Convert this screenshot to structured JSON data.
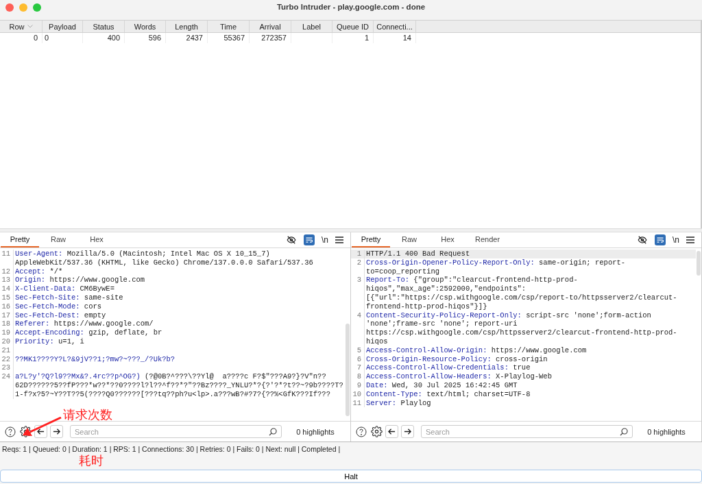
{
  "window": {
    "title": "Turbo Intruder - play.google.com - done"
  },
  "table": {
    "columns": [
      {
        "label": "Row",
        "sorted": true
      },
      {
        "label": "Payload",
        "sorted": false
      },
      {
        "label": "Status",
        "sorted": false
      },
      {
        "label": "Words",
        "sorted": false
      },
      {
        "label": "Length",
        "sorted": false
      },
      {
        "label": "Time",
        "sorted": false
      },
      {
        "label": "Arrival",
        "sorted": false
      },
      {
        "label": "Label",
        "sorted": false
      },
      {
        "label": "Queue ID",
        "sorted": false
      },
      {
        "label": "Connecti...",
        "sorted": false
      }
    ],
    "rows": [
      {
        "cells": [
          "0",
          "0",
          "400",
          "596",
          "2437",
          "55367",
          "272357",
          null,
          "1",
          "14"
        ]
      }
    ]
  },
  "panes": [
    {
      "tabs": [
        {
          "label": "Pretty",
          "selected": true
        },
        {
          "label": "Raw",
          "selected": false
        },
        {
          "label": "Hex",
          "selected": false
        }
      ],
      "toolbar": {
        "hide_on": false,
        "wrap_on": true,
        "newline_label": "\\n"
      },
      "lines": [
        {
          "num": "11",
          "key": "User-Agent:",
          "value": "Mozilla/5.0 (Macintosh; Intel Mac OS X 10_15_7) AppleWebKit/537.36 (KHTML, like Gecko) Chrome/137.0.0.0 Safari/537.36",
          "selected": false
        },
        {
          "num": "12",
          "key": "Accept:",
          "value": "*/*",
          "selected": false
        },
        {
          "num": "13",
          "key": "Origin:",
          "value": "https://www.google.com",
          "selected": false
        },
        {
          "num": "14",
          "key": "X-Client-Data:",
          "value": "CM6BywE=",
          "selected": false
        },
        {
          "num": "15",
          "key": "Sec-Fetch-Site:",
          "value": "same-site",
          "selected": false
        },
        {
          "num": "16",
          "key": "Sec-Fetch-Mode:",
          "value": "cors",
          "selected": false
        },
        {
          "num": "17",
          "key": "Sec-Fetch-Dest:",
          "value": "empty",
          "selected": false
        },
        {
          "num": "18",
          "key": "Referer:",
          "value": "https://www.google.com/",
          "selected": false
        },
        {
          "num": "19",
          "key": "Accept-Encoding:",
          "value": "gzip, deflate, br",
          "selected": false
        },
        {
          "num": "20",
          "key": "Priority:",
          "value": "u=1, i",
          "selected": false
        },
        {
          "num": "21",
          "selected": false
        },
        {
          "num": "22",
          "key": "??MK1????Y?L?&9jV??1;?mw?~???_/?Uk?b?",
          "selected": false
        },
        {
          "num": "23",
          "selected": false
        },
        {
          "num": "24",
          "key": "a?L?y'?Q?l9??Mx&?.4rc??p^OG?)",
          "value": "(?@0B?^???\\??Yl@  a????c F?$\"???A9?}?V\"n??62D??????5??fP???*w??*??0????l?l??^f??*?\"??Bz????_YNLU?*?{?'?*?t??~?9b????T?1-f?x?5?~Y??T??5(????Q0??????[???tq??ph?u<lp>.a???wB?#?7?{??%<GfK???If???",
          "selected": false
        }
      ],
      "search": {
        "placeholder": "Search",
        "highlights": "0 highlights"
      }
    },
    {
      "tabs": [
        {
          "label": "Pretty",
          "selected": true
        },
        {
          "label": "Raw",
          "selected": false
        },
        {
          "label": "Hex",
          "selected": false
        },
        {
          "label": "Render",
          "selected": false
        }
      ],
      "toolbar": {
        "hide_on": false,
        "wrap_on": true,
        "newline_label": "\\n"
      },
      "lines": [
        {
          "num": "1",
          "value": "HTTP/1.1 400 Bad Request",
          "selected": true
        },
        {
          "num": "2",
          "key": "Cross-Origin-Opener-Policy-Report-Only:",
          "value": "same-origin; report-to=coop_reporting",
          "selected": false
        },
        {
          "num": "3",
          "key": "Report-To:",
          "value": "{\"group\":\"clearcut-frontend-http-prod-hiqos\",\"max_age\":2592000,\"endpoints\":[{\"url\":\"https://csp.withgoogle.com/csp/report-to/httpsserver2/clearcut-frontend-http-prod-hiqos\"}]}",
          "selected": false
        },
        {
          "num": "4",
          "key": "Content-Security-Policy-Report-Only:",
          "value": "script-src 'none';form-action 'none';frame-src 'none'; report-uri https://csp.withgoogle.com/csp/httpsserver2/clearcut-frontend-http-prod-hiqos",
          "selected": false
        },
        {
          "num": "5",
          "key": "Access-Control-Allow-Origin:",
          "value": "https://www.google.com",
          "selected": false
        },
        {
          "num": "6",
          "key": "Cross-Origin-Resource-Policy:",
          "value": "cross-origin",
          "selected": false
        },
        {
          "num": "7",
          "key": "Access-Control-Allow-Credentials:",
          "value": "true",
          "selected": false
        },
        {
          "num": "8",
          "key": "Access-Control-Allow-Headers:",
          "value": "X-Playlog-Web",
          "selected": false
        },
        {
          "num": "9",
          "key": "Date:",
          "value": "Wed, 30 Jul 2025 16:42:45 GMT",
          "selected": false
        },
        {
          "num": "10",
          "key": "Content-Type:",
          "value": "text/html; charset=UTF-8",
          "selected": false
        },
        {
          "num": "11",
          "key": "Server:",
          "value": "Playlog",
          "selected": false
        }
      ],
      "search": {
        "placeholder": "Search",
        "highlights": "0 highlights"
      }
    }
  ],
  "status_bar": "Reqs: 1 | Queued: 0 | Duration: 1 | RPS: 1 | Connections: 30 | Retries: 0 | Fails: 0 | Next: null | Completed |",
  "halt_button": "Halt",
  "annotations": [
    {
      "text": "请求次数",
      "color": "#ff2020"
    },
    {
      "text": "耗时",
      "color": "#ff2020"
    }
  ]
}
